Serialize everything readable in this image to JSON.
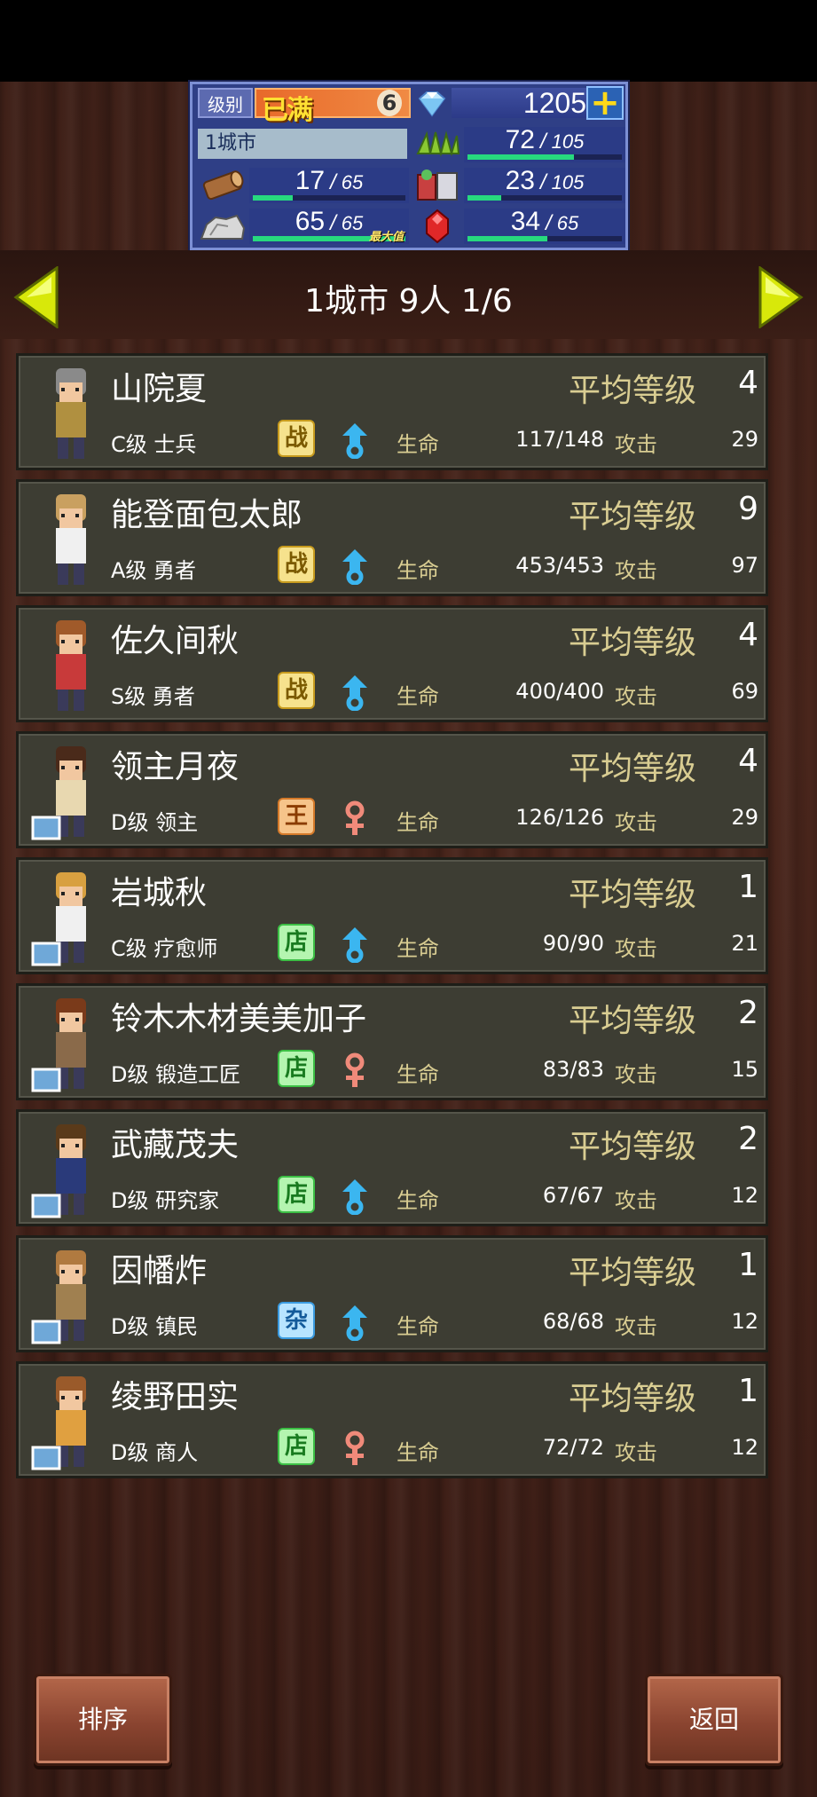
{
  "hud": {
    "level_label": "级别",
    "level_max_text": "已满",
    "level_value": "6",
    "gems": "1205",
    "plus": "+",
    "city": "1城市",
    "food_current": "72",
    "food_max": "105",
    "food_pct": 0.69,
    "wood_current": "17",
    "wood_max": "65",
    "wood_pct": 0.26,
    "goods_current": "23",
    "goods_max": "105",
    "goods_pct": 0.22,
    "ore_current": "65",
    "ore_max": "65",
    "ore_pct": 1.0,
    "ore_max_tag": "最大值",
    "ruby_current": "34",
    "ruby_max": "65",
    "ruby_pct": 0.52,
    "sep": "/"
  },
  "header": {
    "title": "1城市  9人 1/6"
  },
  "labels": {
    "avg_level": "平均等级",
    "hp": "生命",
    "atk": "攻击"
  },
  "characters": [
    {
      "name": "山院夏",
      "avg_level": "4",
      "class": "C级 士兵",
      "badge": "战",
      "badge_type": "zhan",
      "gender": "male",
      "hp": "117/148",
      "atk": "29"
    },
    {
      "name": "能登面包太郎",
      "avg_level": "9",
      "class": "A级 勇者",
      "badge": "战",
      "badge_type": "zhan",
      "gender": "male",
      "hp": "453/453",
      "atk": "97"
    },
    {
      "name": "佐久间秋",
      "avg_level": "4",
      "class": "S级 勇者",
      "badge": "战",
      "badge_type": "zhan",
      "gender": "male",
      "hp": "400/400",
      "atk": "69"
    },
    {
      "name": "领主月夜",
      "avg_level": "4",
      "class": "D级 领主",
      "badge": "王",
      "badge_type": "wang",
      "gender": "female",
      "hp": "126/126",
      "atk": "29"
    },
    {
      "name": "岩城秋",
      "avg_level": "1",
      "class": "C级 疗愈师",
      "badge": "店",
      "badge_type": "dian",
      "gender": "male",
      "hp": "90/90",
      "atk": "21"
    },
    {
      "name": "铃木木材美美加子",
      "avg_level": "2",
      "class": "D级 锻造工匠",
      "badge": "店",
      "badge_type": "dian",
      "gender": "female",
      "hp": "83/83",
      "atk": "15"
    },
    {
      "name": "武藏茂夫",
      "avg_level": "2",
      "class": "D级 研究家",
      "badge": "店",
      "badge_type": "dian",
      "gender": "male",
      "hp": "67/67",
      "atk": "12"
    },
    {
      "name": "因幡炸",
      "avg_level": "1",
      "class": "D级 镇民",
      "badge": "杂",
      "badge_type": "za",
      "gender": "male",
      "hp": "68/68",
      "atk": "12"
    },
    {
      "name": "绫野田实",
      "avg_level": "1",
      "class": "D级 商人",
      "badge": "店",
      "badge_type": "dian",
      "gender": "female",
      "hp": "72/72",
      "atk": "12"
    }
  ],
  "buttons": {
    "sort": "排序",
    "back": "返回"
  },
  "colors": {
    "hud_bg": "#2f3f86",
    "bar_fill": "#27d97e",
    "card_bg": "#3d3d33",
    "label_gold": "#d9cd92",
    "male": "#3bb6f0",
    "female": "#f08a7a"
  }
}
